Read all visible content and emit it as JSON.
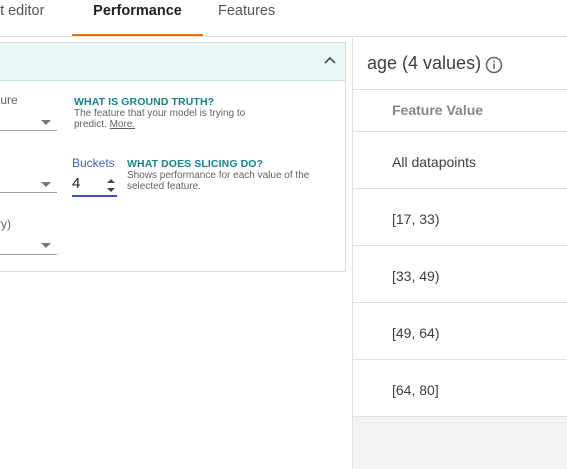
{
  "tabs": [
    {
      "label": "nt editor"
    },
    {
      "label": "Performance"
    },
    {
      "label": "Features"
    }
  ],
  "config": {
    "ground_truth_label": "ture",
    "slice_label": "",
    "third_label": "ry)",
    "ground_truth_help_title": "WHAT IS GROUND TRUTH?",
    "ground_truth_help_text": "The feature that your model is trying to predict.",
    "ground_truth_help_link": "More.",
    "buckets_label": "Buckets",
    "buckets_value": "4",
    "slicing_help_title": "WHAT DOES SLICING DO?",
    "slicing_help_text": "Shows performance for each value of the selected feature."
  },
  "feature_panel": {
    "title": "age (4 values)",
    "column_header": "Feature Value",
    "rows": [
      {
        "value": "All datapoints"
      },
      {
        "value": "[17, 33)"
      },
      {
        "value": "[33, 49)"
      },
      {
        "value": "[49, 64)"
      },
      {
        "value": "[64, 80]"
      }
    ]
  },
  "colors": {
    "accent_tab": "#e8710a",
    "help_title": "#12868b",
    "buckets_accent": "#3c5fc7",
    "header_bg": "#e8f6f8"
  },
  "icons": [
    "chevron-up-icon",
    "dropdown-caret-icon",
    "spinner-arrows-icon",
    "info-icon"
  ]
}
